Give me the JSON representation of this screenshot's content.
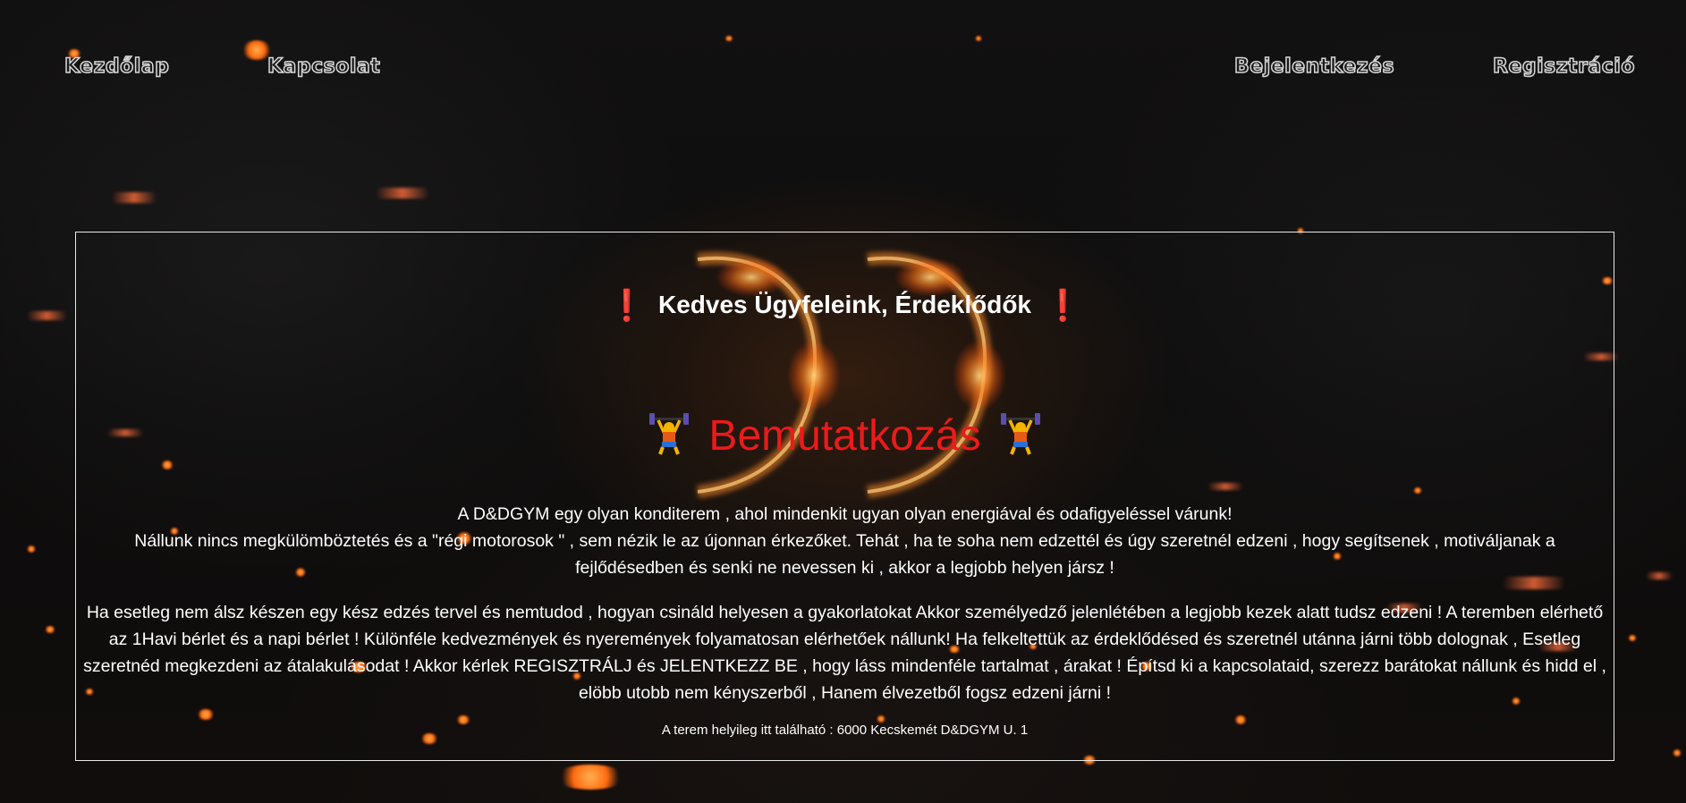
{
  "nav": {
    "home": "Kezdőlap",
    "contact": "Kapcsolat",
    "login": "Bejelentkezés",
    "register": "Regisztráció"
  },
  "info": {
    "greeting": "Kedves Ügyfeleink, Érdeklődők",
    "greeting_marker": "❗",
    "title": "Bemutatkozás",
    "title_icon": "weightlifter-icon",
    "intro_line1": "A D&DGYM egy olyan konditerem , ahol mindenkit ugyan olyan energiával és odafigyeléssel várunk!",
    "intro_line2": "Nállunk nincs megkülömböztetés és a \"régi motorosok \" , sem nézik le az újonnan érkezőket. Tehát , ha te soha nem edzettél és úgy szeretnél edzeni , hogy segítsenek , motiváljanak a fejlődésedben és senki ne nevessen ki , akkor a legjobb helyen jársz !",
    "paragraph2": "Ha esetleg nem álsz készen egy kész edzés tervel és nemtudod , hogyan csináld helyesen a gyakorlatokat Akkor személyedző jelenlétében a legjobb kezek alatt tudsz edzeni ! A teremben elérhető az 1Havi bérlet és a napi bérlet ! Különféle kedvezmények és nyeremények folyamatosan elérhetőek nállunk! Ha felkeltettük az érdeklődésed és szeretnél utánna járni több dolognak , Esetleg szeretnéd megkezdeni az átalakulásodat ! Akkor kérlek REGISZTRÁLJ és JELENTKEZZ BE , hogy láss mindenféle tartalmat , árakat ! Építsd ki a kapcsolataid, szerezz barátokat nállunk és hidd el , elöbb utobb nem kényszerből , Hanem élvezetből fogsz edzeni járni !",
    "address": "A terem helyileg itt található : 6000 Kecskemét D&DGYM U. 1"
  },
  "colors": {
    "accent_red": "#ec1a1a",
    "exclamation_red": "#e0202a",
    "text": "#ffffff",
    "background": "#0b0a0a"
  }
}
